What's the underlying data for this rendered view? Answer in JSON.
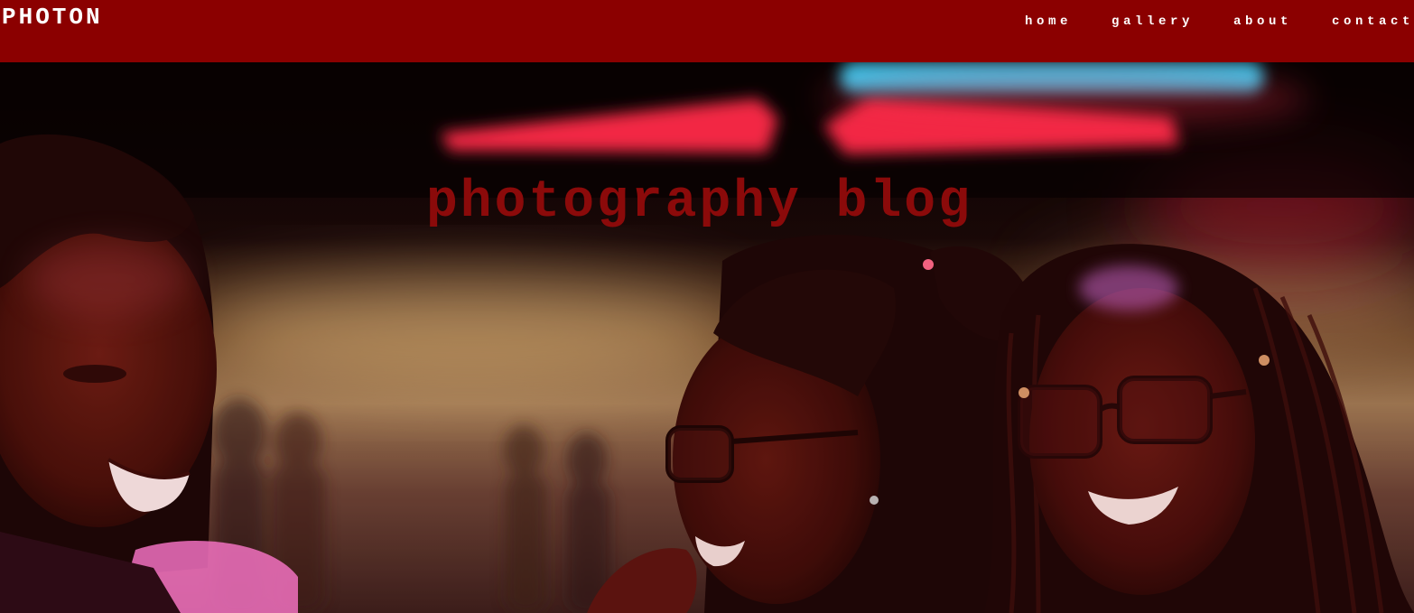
{
  "header": {
    "brand": "PHOTON",
    "nav": [
      {
        "label": "home"
      },
      {
        "label": "gallery"
      },
      {
        "label": "about"
      },
      {
        "label": "contact"
      }
    ]
  },
  "hero": {
    "title": "photography blog",
    "image_alt": "three smiling women photographed at night under colored lights"
  },
  "colors": {
    "brand_red": "#8b0000",
    "title_red": "#8b0a0a",
    "nav_text": "#ffffff"
  }
}
